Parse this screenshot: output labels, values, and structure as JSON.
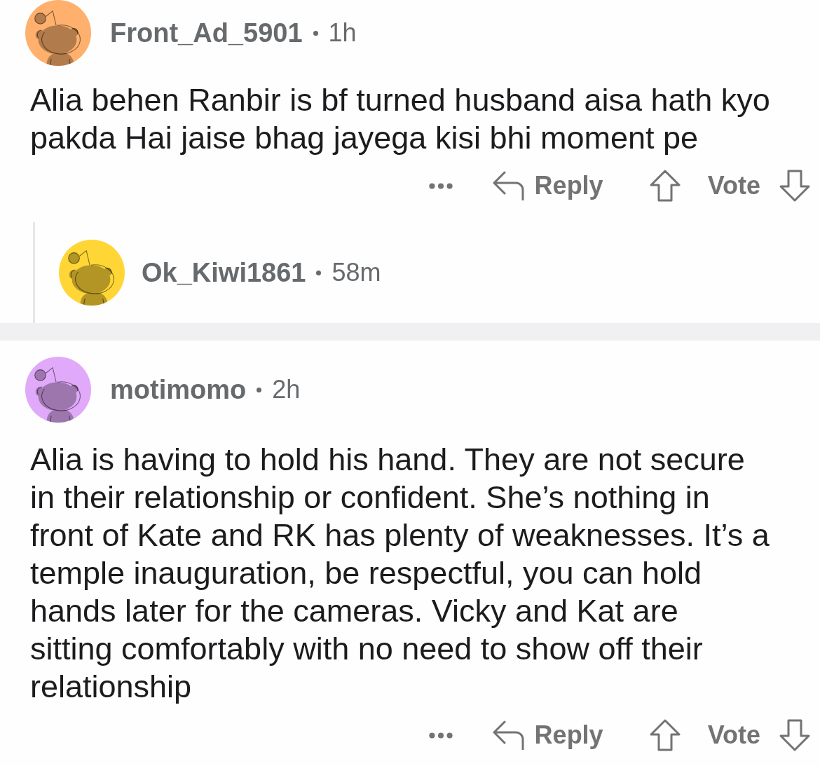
{
  "comments": [
    {
      "author": "Front_Ad_5901",
      "age": "1h",
      "color": "#feb06c",
      "body": "Alia behen Ranbir is bf turned husband aisa hath kyo\npakda Hai jaise bhag jayega kisi bhi moment pe",
      "actions": {
        "reply": "Reply",
        "vote": "Vote"
      },
      "children": [
        {
          "author": "Ok_Kiwi1861",
          "age": "58m",
          "color": "#ffd635"
        }
      ]
    },
    {
      "author": "motimomo",
      "age": "2h",
      "color": "#e1a9f9",
      "body": "Alia is having to hold his hand. They are not secure\nin their relationship or confident. She’s nothing in\nfront of Kate and RK has plenty of weaknesses. It’s a\ntemple inauguration, be respectful, you can hold\nhands later for the cameras. Vicky and Kat are\nsitting comfortably with no need to show off their\nrelationship",
      "actions": {
        "reply": "Reply",
        "vote": "Vote"
      }
    }
  ]
}
